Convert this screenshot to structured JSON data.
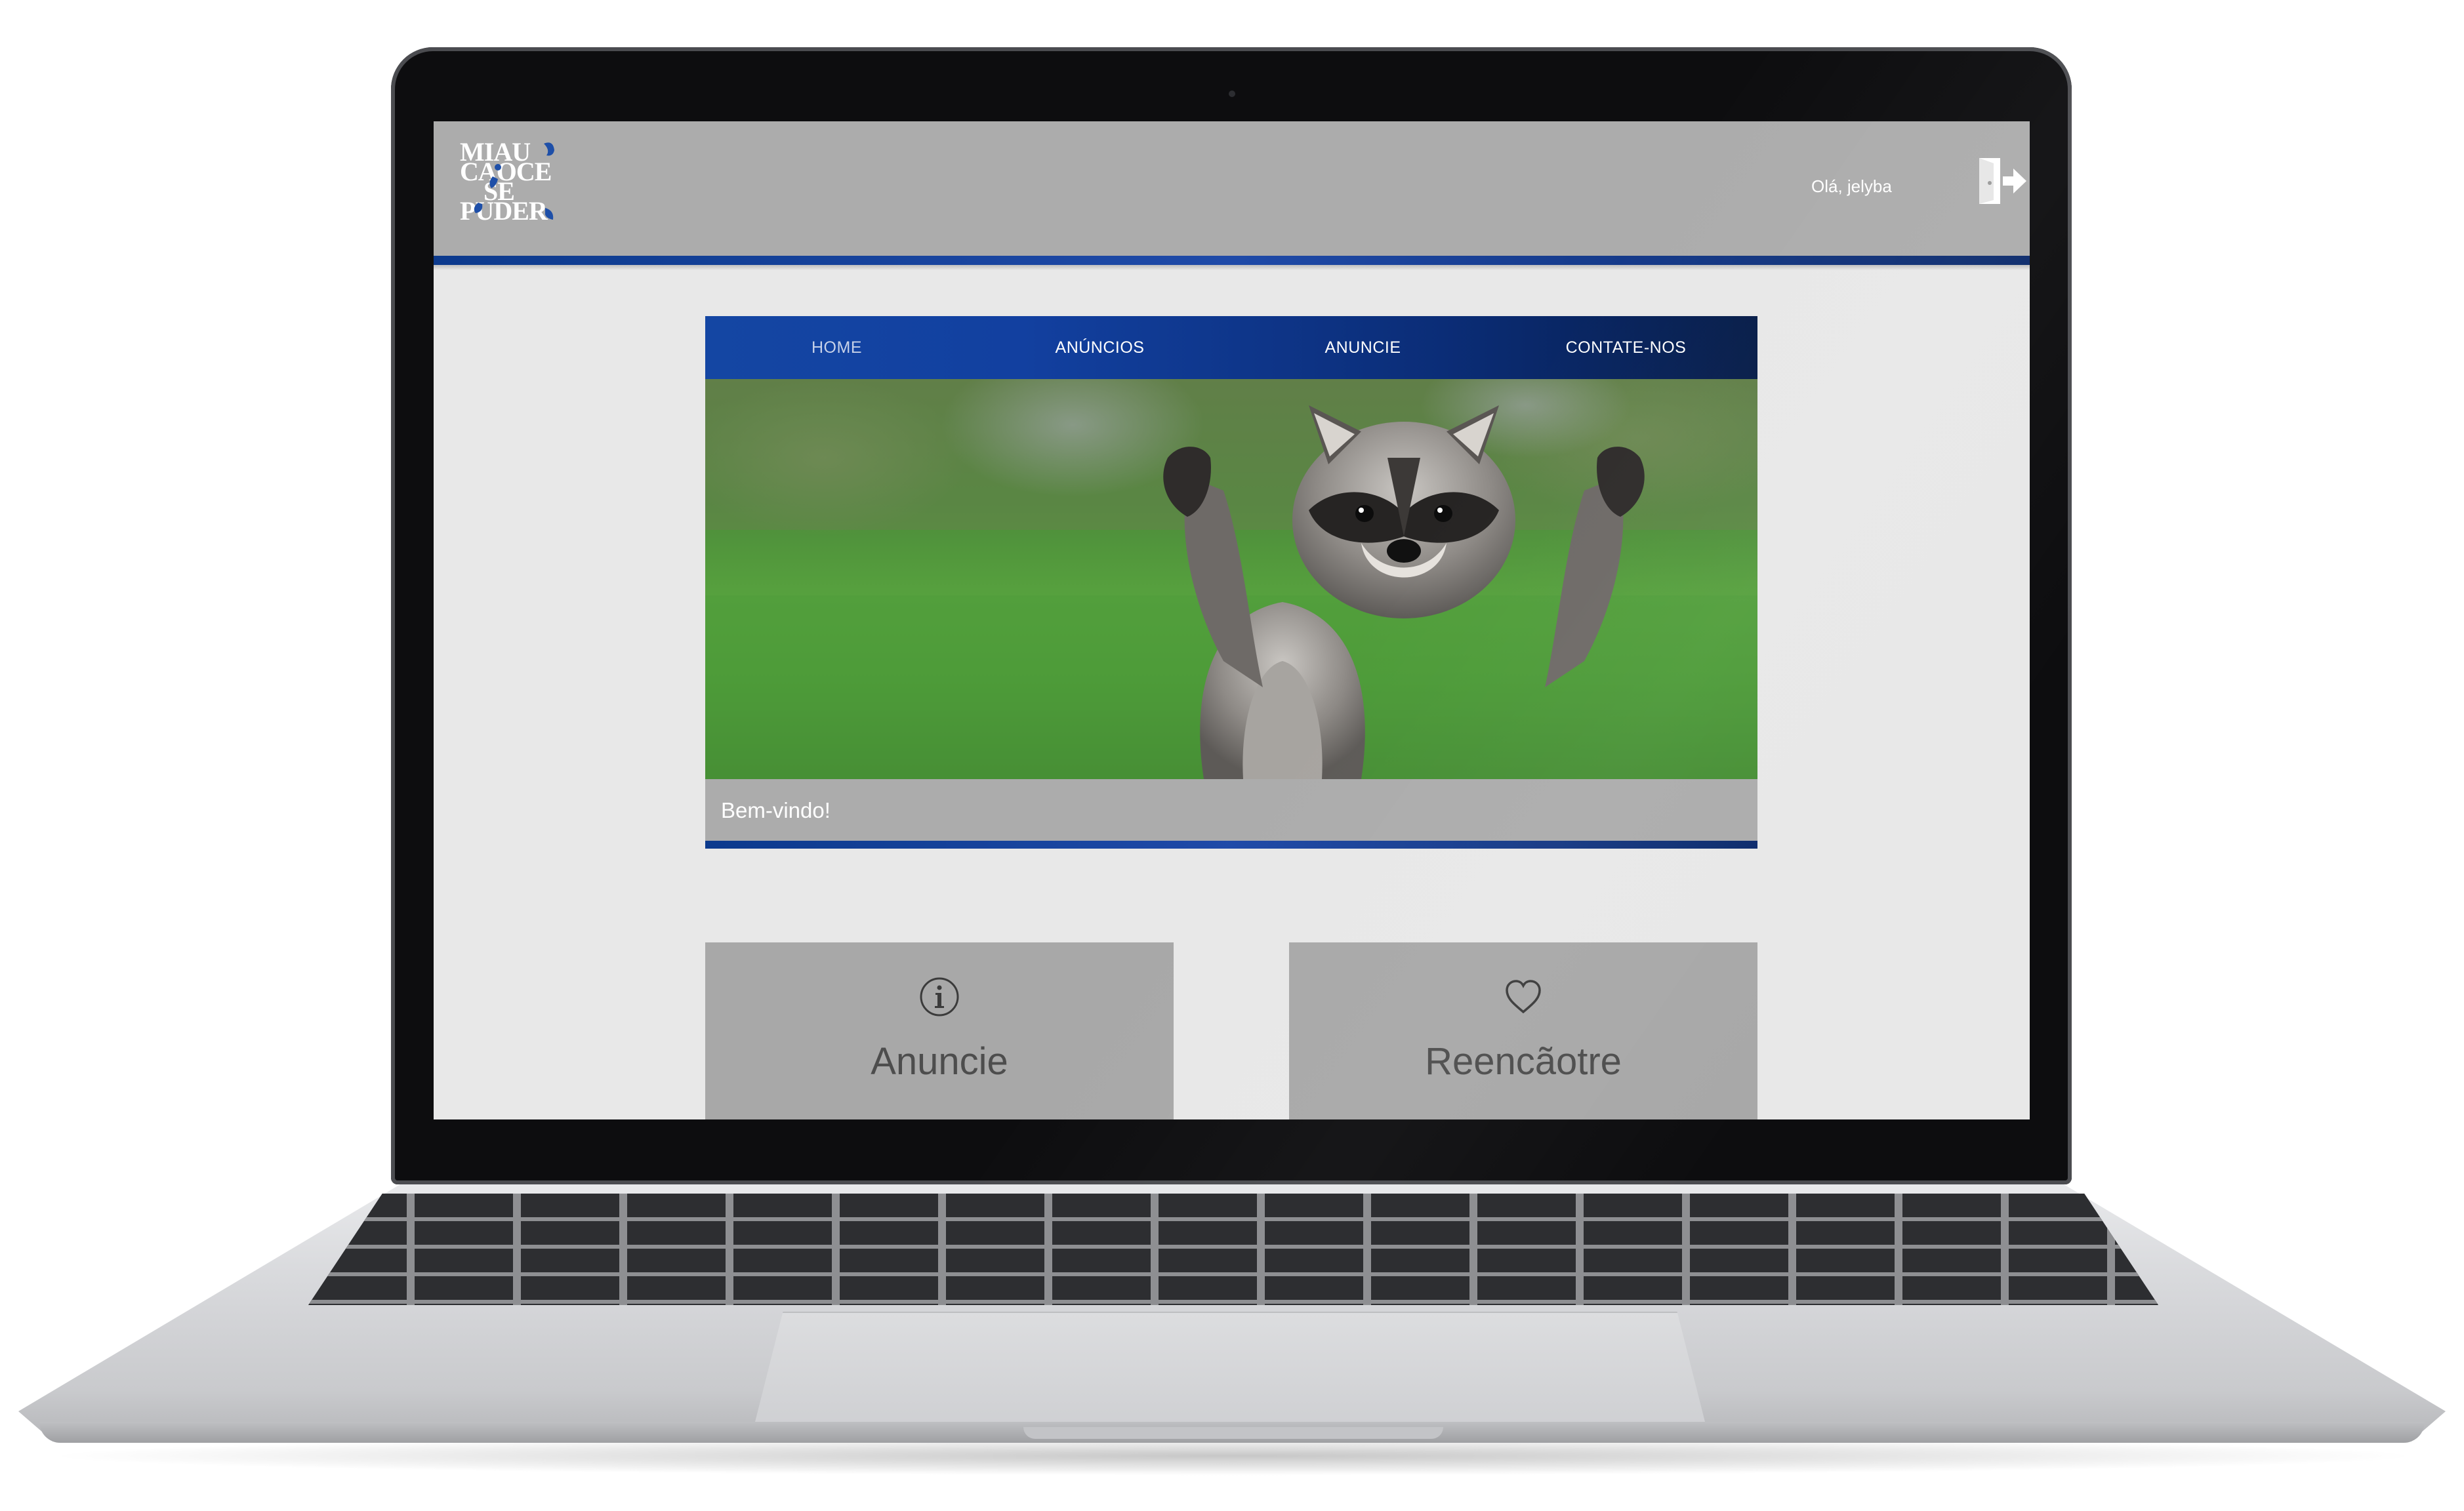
{
  "logo": {
    "lines": [
      "MIAU",
      "CAOCE",
      "SE",
      "PUDER"
    ]
  },
  "header": {
    "greeting": "Olá, jelyba",
    "logout_icon": "logout-door-icon"
  },
  "nav": {
    "items": [
      {
        "label": "HOME",
        "active": true
      },
      {
        "label": "ANÚNCIOS",
        "active": false
      },
      {
        "label": "ANUNCIE",
        "active": false
      },
      {
        "label": "CONTATE-NOS",
        "active": false
      }
    ]
  },
  "hero": {
    "caption": "Bem-vindo!",
    "image": "raccoon-photo"
  },
  "cards": [
    {
      "title": "Anuncie",
      "icon": "info-icon"
    },
    {
      "title": "Reencãotre",
      "icon": "heart-icon"
    }
  ],
  "colors": {
    "header_bg": "#acacac",
    "accent_blue": "#1446a3",
    "page_bg": "#e8e8e8",
    "card_bg": "#a8a8a8"
  }
}
